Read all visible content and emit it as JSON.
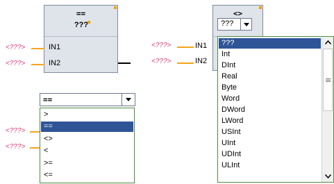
{
  "left_block": {
    "operator": "==",
    "type": "???",
    "inputs": [
      "IN1",
      "IN2"
    ],
    "params": [
      "<???>",
      "<???>"
    ]
  },
  "right_block": {
    "operator": "<>",
    "type_value": "???",
    "inputs": [
      "IN1",
      "IN2"
    ],
    "params": [
      "<???>",
      "<???>"
    ],
    "type_list": {
      "items": [
        "???",
        "Int",
        "DInt",
        "Real",
        "Byte",
        "Word",
        "DWord",
        "LWord",
        "USInt",
        "UInt",
        "UDInt",
        "ULInt"
      ],
      "selected_index": 0
    }
  },
  "operator_combo": {
    "value": "==",
    "items": [
      ">",
      "==",
      "<>",
      "<",
      ">=",
      "<="
    ],
    "selected_index": 1,
    "params": [
      "<???>",
      "<???>"
    ]
  },
  "colors": {
    "selection": "#2f5597",
    "param_text": "#e23b7c",
    "wire": "#f4a41c",
    "list_border": "#4c8a3e"
  }
}
